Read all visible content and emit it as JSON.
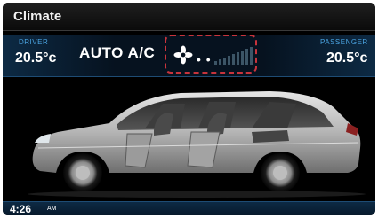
{
  "screen": {
    "title": "Climate"
  },
  "driver": {
    "label": "DRIVER",
    "temperature": "20.5°c"
  },
  "passenger": {
    "label": "PASSENGER",
    "temperature": "20.5°c"
  },
  "mode": {
    "label": "AUTO A/C"
  },
  "fan": {
    "icon": "fan-icon",
    "level_dots": "• •"
  },
  "clock": {
    "time": "4:26",
    "period": "AM"
  },
  "colors": {
    "accent": "#4aa3e0",
    "highlight": "#c8343c",
    "band": "#0d2a44"
  }
}
